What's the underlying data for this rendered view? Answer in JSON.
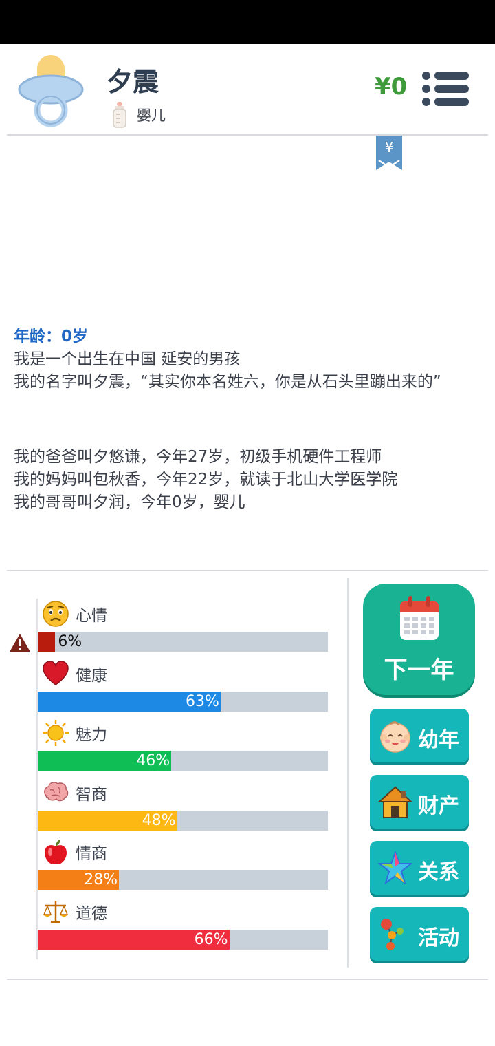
{
  "header": {
    "player_name": "夕震",
    "stage_label": "婴儿",
    "money": "¥0"
  },
  "story": {
    "age_line": "年龄：0岁",
    "lines": [
      "我是一个出生在中国 延安的男孩",
      "我的名字叫夕震，“其实你本名姓六，你是从石头里蹦出来的”"
    ],
    "family": [
      "我的爸爸叫夕悠谦，今年27岁，初级手机硬件工程师",
      "我的妈妈叫包秋香，今年22岁，就读于北山大学医学院",
      "我的哥哥叫夕润，今年0岁，婴儿"
    ]
  },
  "stats": [
    {
      "label": "心情",
      "value": 6,
      "text": "6%",
      "color": "#b71c0c",
      "icon": "sad-face-icon",
      "warning": true
    },
    {
      "label": "健康",
      "value": 63,
      "text": "63%",
      "color": "#1e88e5",
      "icon": "heart-icon"
    },
    {
      "label": "魅力",
      "value": 46,
      "text": "46%",
      "color": "#0fbf55",
      "icon": "sun-icon"
    },
    {
      "label": "智商",
      "value": 48,
      "text": "48%",
      "color": "#fdb813",
      "icon": "brain-icon"
    },
    {
      "label": "情商",
      "value": 28,
      "text": "28%",
      "color": "#f57f17",
      "icon": "apple-icon"
    },
    {
      "label": "道德",
      "value": 66,
      "text": "66%",
      "color": "#ef2d3e",
      "icon": "scales-icon"
    }
  ],
  "buttons": {
    "next_year": "下一年",
    "childhood": "幼年",
    "assets": "财产",
    "relations": "关系",
    "activities": "活动"
  },
  "colors": {
    "accent_green": "#19b394",
    "button_teal": "#16b7b9",
    "money_green": "#3e9a3b",
    "age_blue": "#1f67c6"
  }
}
